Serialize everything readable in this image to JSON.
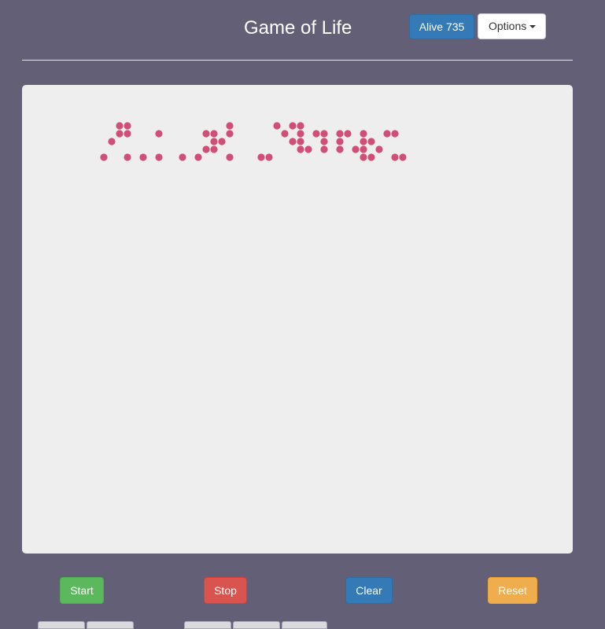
{
  "header": {
    "title": "Game of Life",
    "alive_label": "Alive",
    "alive_count": "735",
    "options_label": "Options"
  },
  "board": {
    "cell_color": "#cf4f78",
    "panel_color": "#eeeeee",
    "rows": [
      "00110000000000001000001011000000000000000",
      "00110001000001101000000101011011010011000",
      "01000000000000110000000011001010011000000",
      "00000000000001100000000001101010110100000",
      "10010101001010001000110000000000011001100",
      "00000000000000000000000000000000000000000"
    ]
  },
  "controls": {
    "start_label": "Start",
    "stop_label": "Stop",
    "clear_label": "Clear",
    "reset_label": "Reset"
  },
  "colors": {
    "background": "#625f77",
    "start": "#5cb85c",
    "stop": "#d9534f",
    "clear": "#337ab7",
    "reset": "#f0ad4e"
  }
}
